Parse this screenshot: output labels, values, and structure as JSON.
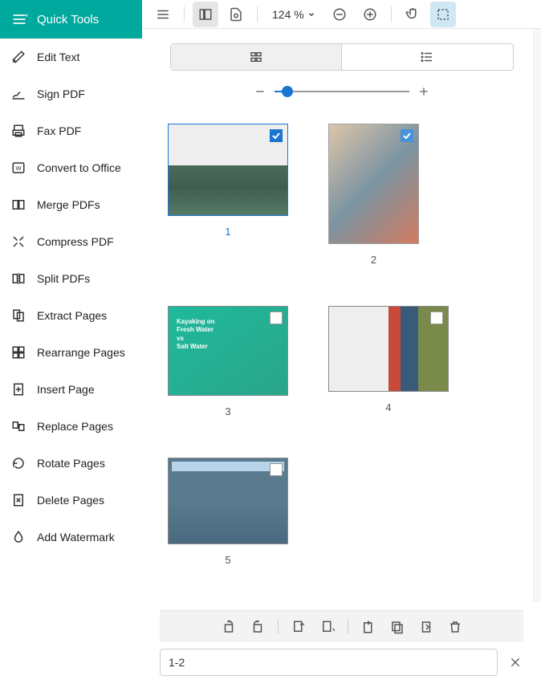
{
  "sidebar": {
    "header": "Quick Tools",
    "items": [
      {
        "label": "Edit Text"
      },
      {
        "label": "Sign PDF"
      },
      {
        "label": "Fax PDF"
      },
      {
        "label": "Convert to Office"
      },
      {
        "label": "Merge PDFs"
      },
      {
        "label": "Compress PDF"
      },
      {
        "label": "Split PDFs"
      },
      {
        "label": "Extract Pages"
      },
      {
        "label": "Rearrange Pages"
      },
      {
        "label": "Insert Page"
      },
      {
        "label": "Replace Pages"
      },
      {
        "label": "Rotate Pages"
      },
      {
        "label": "Delete Pages"
      },
      {
        "label": "Add Watermark"
      }
    ]
  },
  "toolbar": {
    "zoom": "124 %"
  },
  "thumbnails": {
    "items": [
      {
        "num": "1",
        "selected": true,
        "checked": true,
        "title_lines": []
      },
      {
        "num": "2",
        "selected": false,
        "checked": true,
        "title_lines": []
      },
      {
        "num": "3",
        "selected": false,
        "checked": false,
        "title_lines": [
          "Kayaking on",
          "Fresh Water",
          "vs",
          "Salt Water"
        ]
      },
      {
        "num": "4",
        "selected": false,
        "checked": false,
        "title_lines": []
      },
      {
        "num": "5",
        "selected": false,
        "checked": false,
        "title_lines": []
      }
    ]
  },
  "bottom": {
    "range": "1-2"
  }
}
